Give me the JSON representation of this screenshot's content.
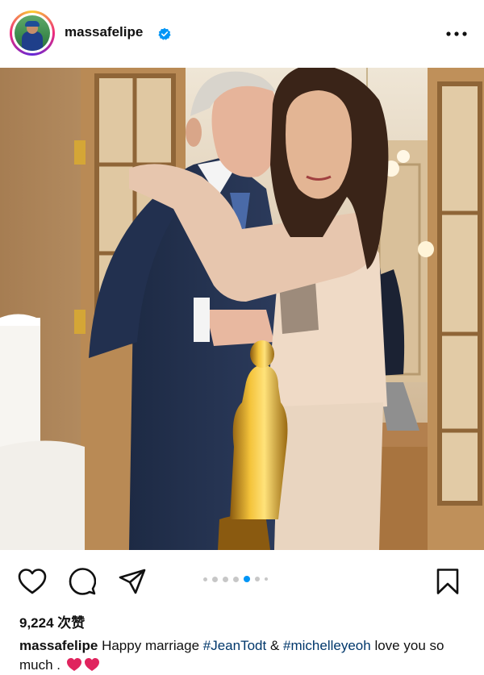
{
  "post": {
    "username": "massafelipe",
    "likes_text": "9,224 次赞",
    "caption": {
      "username": "massafelipe",
      "text_before": "Happy marriage",
      "hashtag1": "#JeanTodt",
      "amp": "&",
      "hashtag2": "#michelleyeoh",
      "text_after": "love you so much .",
      "emojis": [
        "red-heart",
        "red-heart"
      ]
    },
    "carousel": {
      "total": 6,
      "active_index": 4
    }
  },
  "colors": {
    "hashtag": "#00376b",
    "verified": "#0095f6",
    "dot_active": "#0095f6",
    "dot_inactive": "#c7c7c7",
    "heart": "#e0245e"
  },
  "icons": [
    "verified-badge-icon",
    "more-options-icon",
    "heart-icon",
    "comment-icon",
    "share-icon",
    "bookmark-icon"
  ]
}
